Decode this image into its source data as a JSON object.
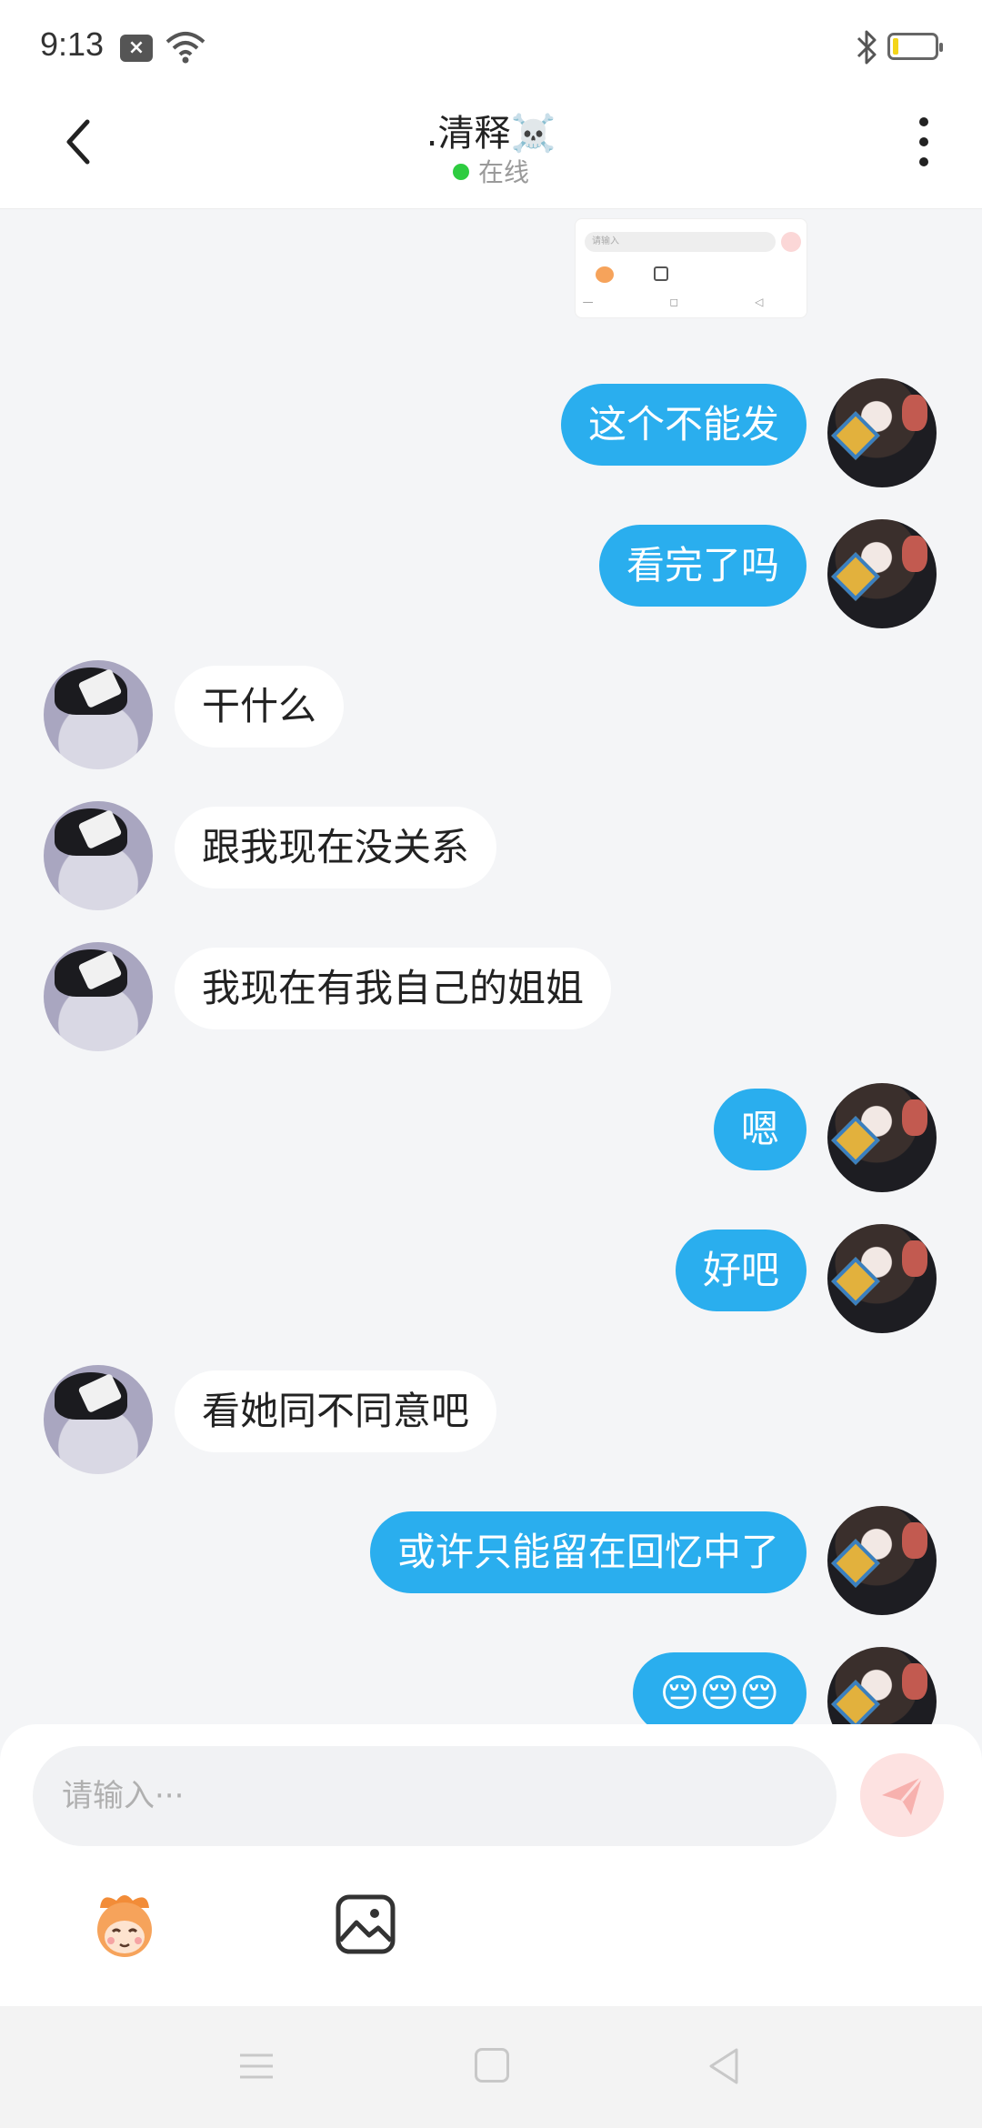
{
  "status_bar": {
    "time": "9:13"
  },
  "header": {
    "title": ".清释☠️",
    "status": "在线"
  },
  "chat": {
    "thumbnail": {
      "input_placeholder": "请输入"
    },
    "messages": [
      {
        "side": "me",
        "text": "这个不能发"
      },
      {
        "side": "me",
        "text": "看完了吗"
      },
      {
        "side": "them",
        "text": "干什么"
      },
      {
        "side": "them",
        "text": "跟我现在没关系"
      },
      {
        "side": "them",
        "text": "我现在有我自己的姐姐"
      },
      {
        "side": "me",
        "text": "嗯"
      },
      {
        "side": "me",
        "text": "好吧"
      },
      {
        "side": "them",
        "text": "看她同不同意吧"
      },
      {
        "side": "me",
        "text": "或许只能留在回忆中了"
      },
      {
        "side": "me",
        "text": "😔😔😔"
      }
    ]
  },
  "composer": {
    "placeholder": "请输入···"
  },
  "icons": {
    "back": "chevron-left-icon",
    "more": "more-vertical-icon",
    "send": "send-icon",
    "emoji": "emoji-icon",
    "image": "image-icon"
  },
  "colors": {
    "my_bubble": "#2aaeee",
    "their_bubble": "#ffffff",
    "online": "#2ecc40",
    "send_button": "#fde2e1",
    "battery": "#f3d51a"
  }
}
